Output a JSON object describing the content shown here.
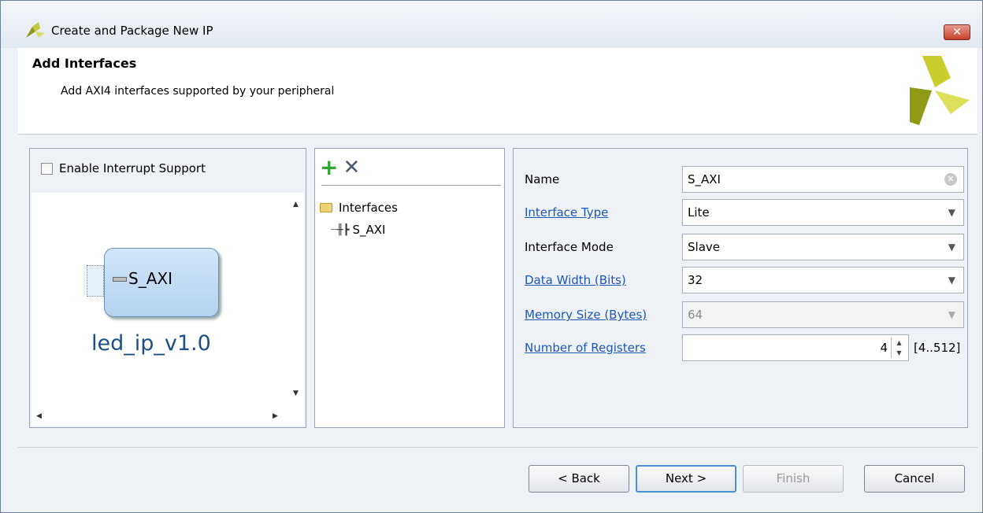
{
  "window": {
    "title": "Create and Package New IP",
    "close_label": "✕"
  },
  "header": {
    "title": "Add Interfaces",
    "subtitle": "Add AXI4 interfaces supported by your peripheral"
  },
  "left_panel": {
    "checkbox_label": "Enable Interrupt Support",
    "checkbox_checked": false,
    "ip_port_label": "S_AXI",
    "ip_name": "led_ip_v1.0"
  },
  "tree": {
    "root_label": "Interfaces",
    "children": [
      "S_AXI"
    ]
  },
  "form": {
    "name": {
      "label": "Name",
      "value": "S_AXI"
    },
    "interface_type": {
      "label": "Interface Type",
      "value": "Lite"
    },
    "interface_mode": {
      "label": "Interface Mode",
      "value": "Slave"
    },
    "data_width": {
      "label": "Data Width (Bits)",
      "value": "32"
    },
    "memory_size": {
      "label": "Memory Size (Bytes)",
      "value": "64"
    },
    "num_registers": {
      "label": "Number of Registers",
      "value": "4",
      "range": "[4..512]"
    }
  },
  "buttons": {
    "back": "< Back",
    "next": "Next >",
    "finish": "Finish",
    "cancel": "Cancel"
  },
  "colors": {
    "link": "#1f57b8",
    "accent": "#4a90d8",
    "brand": "#b8bb26"
  }
}
